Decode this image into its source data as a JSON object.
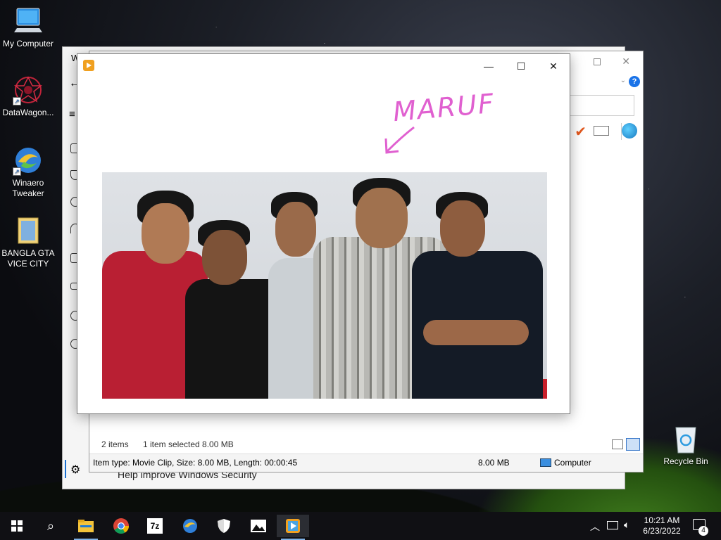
{
  "desktop": {
    "icons": [
      {
        "label": "My Computer",
        "icon": "computer-icon"
      },
      {
        "label": "DataWagon...",
        "icon": "datawagon-icon"
      },
      {
        "label": "Winaero Tweaker",
        "icon": "winaero-icon"
      },
      {
        "label": "BANGLA GTA VICE CITY",
        "icon": "folder-icon"
      },
      {
        "label": "Recycle Bin",
        "icon": "recycle-bin-icon"
      }
    ]
  },
  "background_window": {
    "title_initial": "W",
    "help_glyph": "?",
    "security_lines": [
      "Help improve Windows Security"
    ]
  },
  "viewer": {
    "minimize": "—",
    "maximize": "☐",
    "close": "✕",
    "annotation": "MARUF",
    "photo_desc": "group photo"
  },
  "explorer_status": {
    "items": "2 items",
    "selected": "1 item selected  8.00 MB"
  },
  "details_bar": {
    "item_info": "Item type: Movie Clip, Size: 8.00 MB, Length: 00:00:45",
    "size": "8.00 MB",
    "location": "Computer"
  },
  "taskbar": {
    "apps": [
      "start-icon",
      "search-icon",
      "file-explorer-icon",
      "chrome-icon",
      "7zip-icon",
      "winaero-icon",
      "security-shield-icon",
      "photos-icon",
      "media-player-icon"
    ],
    "sevenzip_label": "7z",
    "time": "10:21 AM",
    "date": "6/23/2022",
    "notification_count": "4"
  }
}
